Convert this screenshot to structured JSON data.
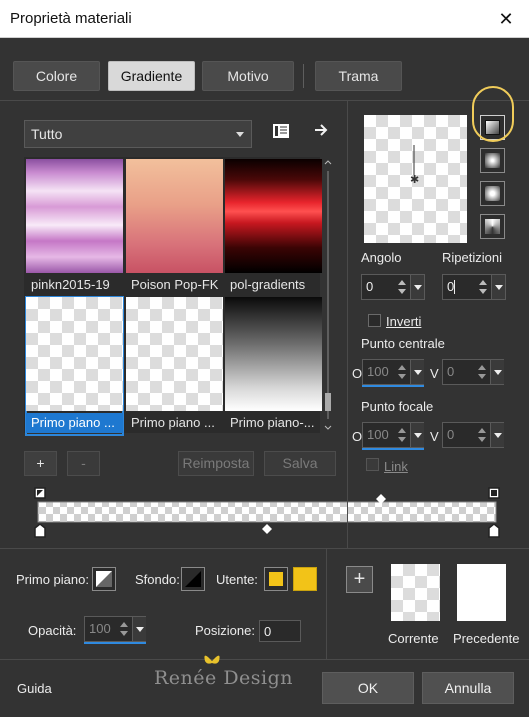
{
  "window": {
    "title": "Proprietà materiali",
    "close_glyph": "✕"
  },
  "tabs": [
    {
      "label": "Colore"
    },
    {
      "label": "Gradiente"
    },
    {
      "label": "Motivo"
    },
    {
      "label": "Trama"
    }
  ],
  "gallery": {
    "category": "Tutto",
    "items": [
      {
        "label": "pinkn2015-19"
      },
      {
        "label": "Poison Pop-FK"
      },
      {
        "label": "pol-gradients"
      },
      {
        "label": "Primo piano ..."
      },
      {
        "label": "Primo piano ..."
      },
      {
        "label": "Primo piano-..."
      }
    ],
    "selected_index": 3
  },
  "gradient_buttons": {
    "add": "+",
    "remove": "-",
    "reset": "Reimposta",
    "save": "Salva"
  },
  "settings": {
    "angle_label": "Angolo",
    "angle_value": "0",
    "repeats_label": "Ripetizioni",
    "repeats_value": "0",
    "invert_label": "Inverti",
    "center_point_label": "Punto centrale",
    "center_h_label": "O",
    "center_h_value": "100",
    "center_v_label": "V",
    "center_v_value": "0",
    "focal_point_label": "Punto focale",
    "focal_h_label": "O",
    "focal_h_value": "100",
    "focal_v_label": "V",
    "focal_v_value": "0",
    "link_label": "Link"
  },
  "bottom": {
    "foreground_label": "Primo piano:",
    "background_label": "Sfondo:",
    "user_label": "Utente:",
    "user_color": "#f2c318",
    "opacity_label": "Opacità:",
    "opacity_value": "100",
    "position_label": "Posizione:",
    "position_value": "0",
    "add_glyph": "+",
    "current_label": "Corrente",
    "previous_label": "Precedente"
  },
  "watermark": "Renée Design",
  "footer": {
    "help_label": "Guida",
    "ok_label": "OK",
    "cancel_label": "Annulla"
  },
  "colors": {
    "accent_blue": "#2f8ae0",
    "highlight_yellow": "#f0cc5a"
  }
}
